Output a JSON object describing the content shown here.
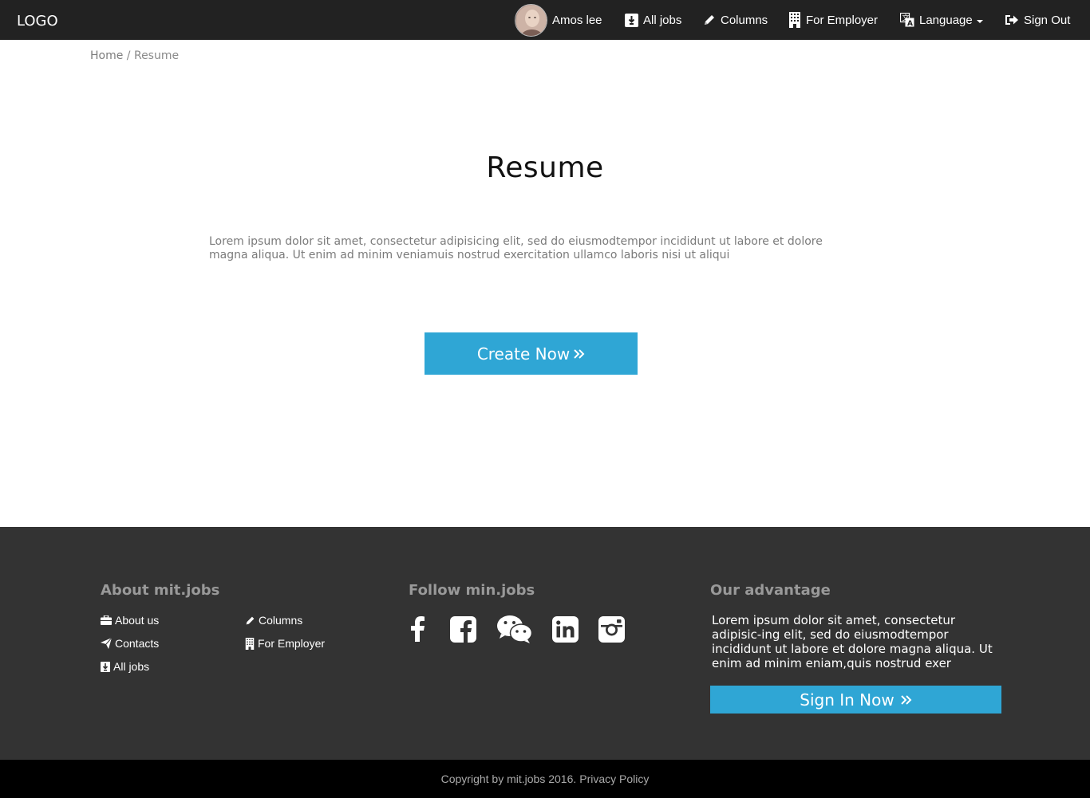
{
  "navbar": {
    "logo": "LOGO",
    "user_name": "Amos lee",
    "all_jobs": "All jobs",
    "columns": "Columns",
    "for_employer": "For Employer",
    "language": "Language",
    "sign_out": "Sign Out"
  },
  "breadcrumb": {
    "home": "Home",
    "separator": "/",
    "current": "Resume"
  },
  "main": {
    "title": "Resume",
    "intro": "Lorem ipsum dolor sit amet, consectetur adipisicing elit, sed do eiusmodtempor incididunt ut labore et dolore magna aliqua. Ut enim ad minim veniamuis nostrud exercitation ullamco laboris nisi ut aliqui",
    "create_button": "Create Now"
  },
  "footer": {
    "about_heading": "About mit.jobs",
    "about_links": {
      "about_us": "About us",
      "contacts": "Contacts",
      "all_jobs": "All jobs",
      "columns": "Columns",
      "for_employer": "For Employer"
    },
    "follow_heading": "Follow min.jobs",
    "social_icons": [
      "facebook-icon",
      "facebook-square-icon",
      "wechat-icon",
      "linkedin-icon",
      "instagram-icon"
    ],
    "advantage_heading": "Our advantage",
    "advantage_text": "Lorem ipsum dolor sit amet, consectetur adipisic-ing elit, sed do eiusmodtempor incididunt ut labore et dolore magna aliqua. Ut enim ad minim eniam,quis nostrud exer",
    "signin_button": "Sign In Now"
  },
  "bottom": {
    "copyright": "Copyright by mit.jobs 2016.",
    "privacy": "Privacy Policy"
  },
  "colors": {
    "navbar_bg": "#222222",
    "accent": "#2fa6d5",
    "footer_bg": "#333333",
    "bottom_bg": "#000000"
  }
}
